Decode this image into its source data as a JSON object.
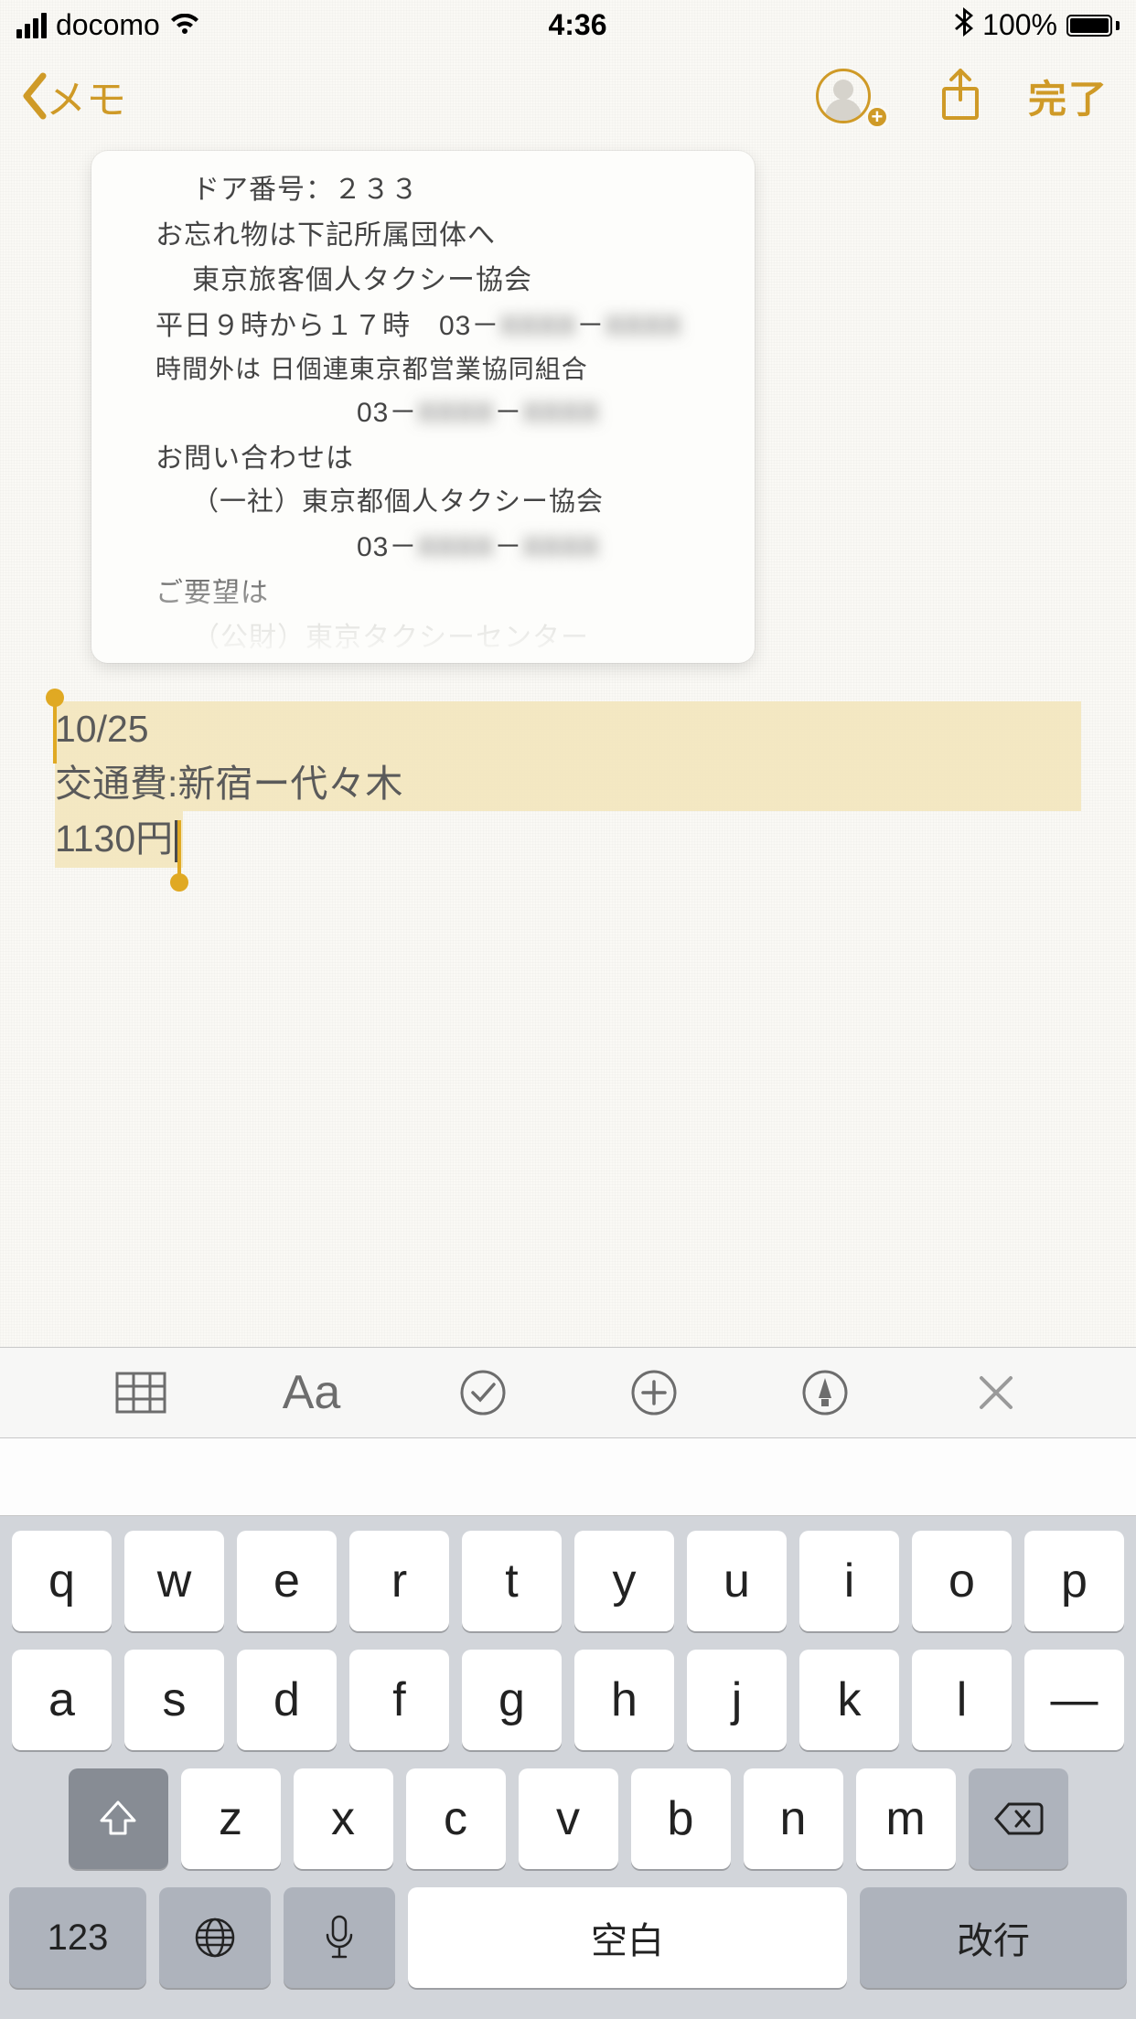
{
  "status": {
    "carrier": "docomo",
    "time": "4:36",
    "battery_pct": "100%"
  },
  "nav": {
    "back_label": "メモ",
    "done_label": "完了"
  },
  "receipt": {
    "lines": [
      "ドア番号：２３３",
      "お忘れ物は下記所属団体へ",
      "東京旅客個人タクシー協会",
      "平日９時から１７時　03－",
      "時間外は 日個連東京都営業協同組合",
      "03－",
      "お問い合わせは",
      "（一社）東京都個人タクシー協会",
      "03－",
      "ご要望は",
      "（公財）東京タクシーセンター"
    ],
    "redacted_a": "XXXX",
    "redacted_b": "XXXX"
  },
  "note": {
    "line1": "10/25",
    "line2": "交通費:新宿ー代々木",
    "line3": "1130円"
  },
  "keyboard": {
    "row1": [
      "q",
      "w",
      "e",
      "r",
      "t",
      "y",
      "u",
      "i",
      "o",
      "p"
    ],
    "row2": [
      "a",
      "s",
      "d",
      "f",
      "g",
      "h",
      "j",
      "k",
      "l",
      "—"
    ],
    "row3": [
      "z",
      "x",
      "c",
      "v",
      "b",
      "n",
      "m"
    ],
    "num_label": "123",
    "space_label": "空白",
    "return_label": "改行"
  }
}
